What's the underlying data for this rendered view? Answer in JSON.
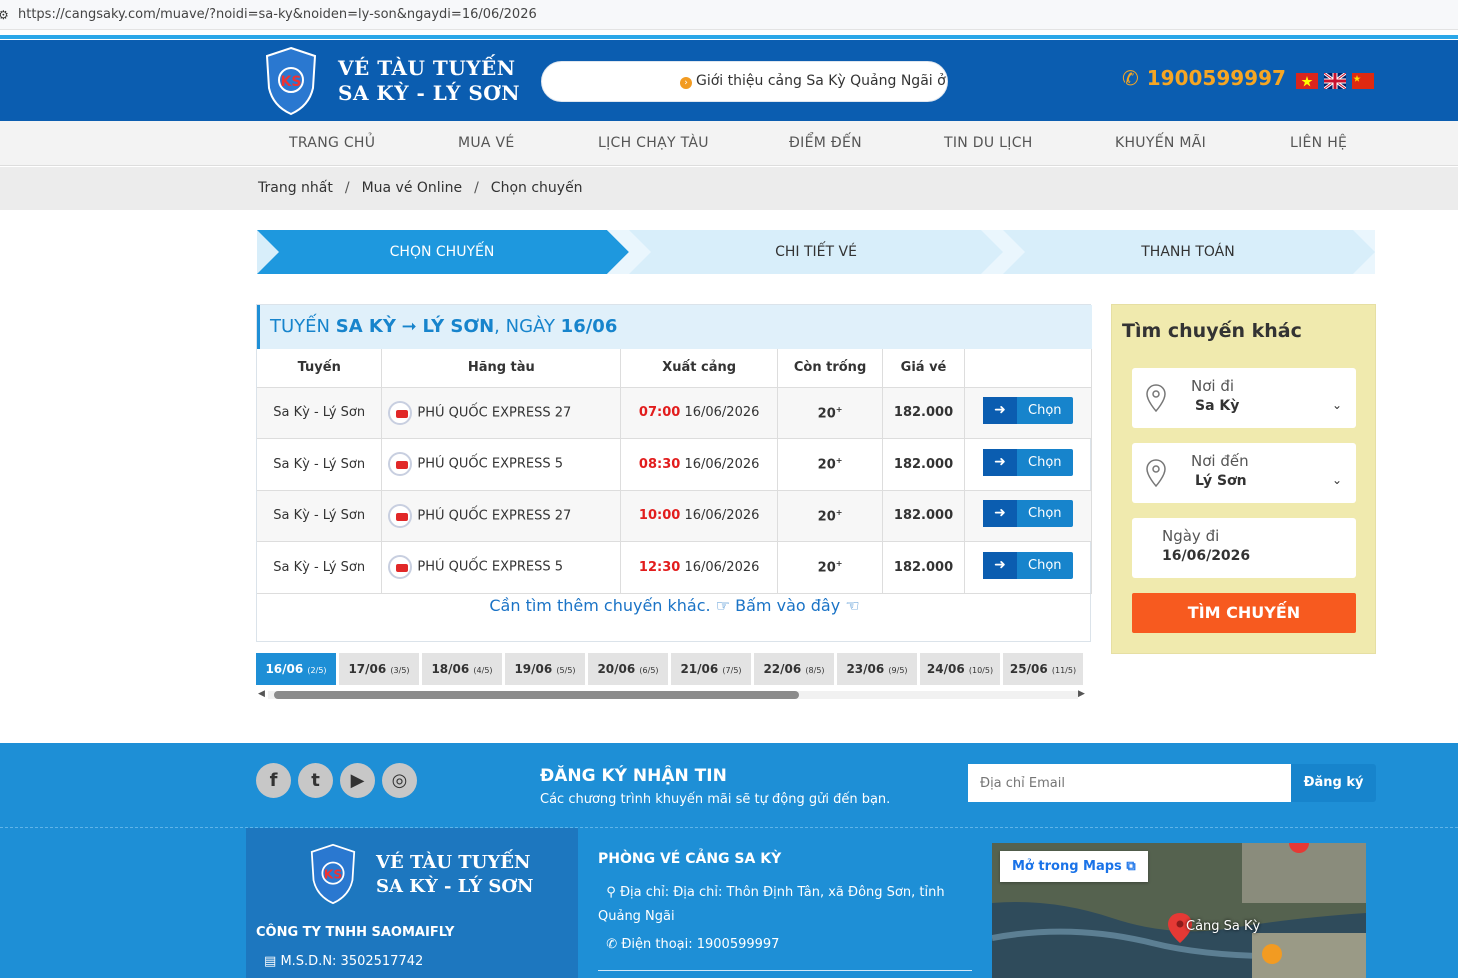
{
  "browser": {
    "url": "https://cangsaky.com/muave/?noidi=sa-ky&noiden=ly-son&ngaydi=16/06/2026"
  },
  "header": {
    "logo_line1": "VÉ TÀU TUYẾN",
    "logo_line2": "SA KỲ - LÝ SƠN",
    "marquee": "Giới thiệu cảng Sa Kỳ Quảng Ngãi ở đâ",
    "hotline": "1900599997"
  },
  "nav": [
    "TRANG CHỦ",
    "MUA VÉ",
    "LỊCH CHẠY TÀU",
    "ĐIỂM ĐẾN",
    "TIN DU LỊCH",
    "KHUYẾN MÃI",
    "LIÊN HỆ"
  ],
  "breadcrumb": [
    "Trang nhất",
    "Mua vé Online",
    "Chọn chuyến"
  ],
  "steps": [
    "CHỌN CHUYẾN",
    "CHI TIẾT VÉ",
    "THANH TOÁN"
  ],
  "route": {
    "prefix": "TUYẾN ",
    "from": "SA KỲ",
    "arrow": "➞",
    "to": "LÝ SƠN",
    "mid": ", NGÀY ",
    "date": "16/06"
  },
  "table": {
    "headers": [
      "Tuyến",
      "Hãng tàu",
      "Xuất cảng",
      "Còn trống",
      "Giá vé",
      ""
    ],
    "rows": [
      {
        "route": "Sa Kỳ - Lý Sơn",
        "ship": "PHÚ QUỐC EXPRESS 27",
        "time": "07:00",
        "date": "16/06/2026",
        "seats": "20",
        "plus": "+",
        "price": "182.000",
        "btn": "Chọn"
      },
      {
        "route": "Sa Kỳ - Lý Sơn",
        "ship": "PHÚ QUỐC EXPRESS 5",
        "time": "08:30",
        "date": "16/06/2026",
        "seats": "20",
        "plus": "+",
        "price": "182.000",
        "btn": "Chọn"
      },
      {
        "route": "Sa Kỳ - Lý Sơn",
        "ship": "PHÚ QUỐC EXPRESS 27",
        "time": "10:00",
        "date": "16/06/2026",
        "seats": "20",
        "plus": "+",
        "price": "182.000",
        "btn": "Chọn"
      },
      {
        "route": "Sa Kỳ - Lý Sơn",
        "ship": "PHÚ QUỐC EXPRESS 5",
        "time": "12:30",
        "date": "16/06/2026",
        "seats": "20",
        "plus": "+",
        "price": "182.000",
        "btn": "Chọn"
      }
    ],
    "more_text": "Cần tìm thêm chuyến khác.",
    "more_link": "Bấm vào đây"
  },
  "dates": [
    {
      "d": "16/06",
      "n": "(2/5)"
    },
    {
      "d": "17/06",
      "n": "(3/5)"
    },
    {
      "d": "18/06",
      "n": "(4/5)"
    },
    {
      "d": "19/06",
      "n": "(5/5)"
    },
    {
      "d": "20/06",
      "n": "(6/5)"
    },
    {
      "d": "21/06",
      "n": "(7/5)"
    },
    {
      "d": "22/06",
      "n": "(8/5)"
    },
    {
      "d": "23/06",
      "n": "(9/5)"
    },
    {
      "d": "24/06",
      "n": "(10/5)"
    },
    {
      "d": "25/06",
      "n": "(11/5)"
    }
  ],
  "search": {
    "title": "Tìm chuyến khác",
    "from_label": "Nơi đi",
    "from_value": "Sa Kỳ",
    "to_label": "Nơi đến",
    "to_value": "Lý Sơn",
    "date_label": "Ngày đi",
    "date_value": "16/06/2026",
    "button": "TÌM CHUYẾN"
  },
  "footer": {
    "newsletter_title": "ĐĂNG KÝ NHẬN TIN",
    "newsletter_sub": "Các chương trình khuyến mãi sẽ tự động gửi đến bạn.",
    "email_placeholder": "Địa chỉ Email",
    "register": "Đăng ký",
    "company": "CÔNG TY TNHH SAOMAIFLY",
    "msdn": "M.S.D.N: 3502517742",
    "office_title": "PHÒNG VÉ CẢNG SA KỲ",
    "address": "Địa chỉ: Địa chỉ: Thôn Định Tân, xã Đông Sơn, tỉnh Quảng Ngãi",
    "phone": "Điện thoại: 1900599997",
    "open_maps": "Mở trong Maps",
    "map_label": "Cảng Sa Kỳ"
  }
}
